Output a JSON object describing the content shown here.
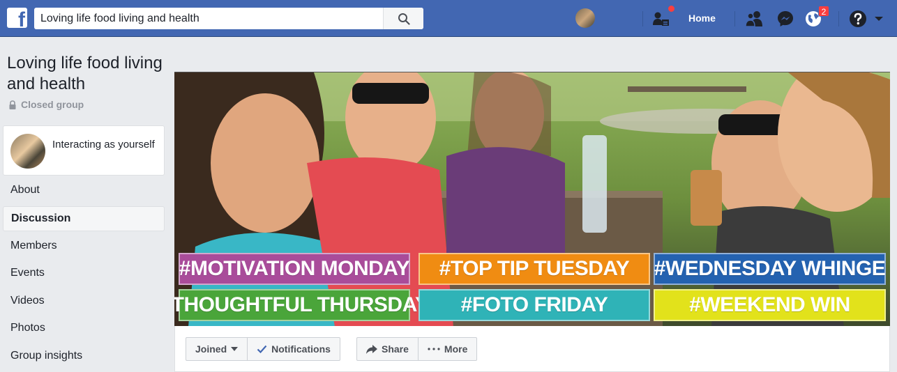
{
  "topbar": {
    "search_value": "Loving life food living and health",
    "home_label": "Home",
    "notifications_count": "2",
    "brand_color": "#4267b2"
  },
  "group": {
    "title": "Loving life food living and health",
    "privacy": "Closed group"
  },
  "interacting": {
    "text": "Interacting as yourself"
  },
  "sidebar": {
    "items": [
      {
        "label": "About"
      },
      {
        "label": "Discussion"
      },
      {
        "label": "Members"
      },
      {
        "label": "Events"
      },
      {
        "label": "Videos"
      },
      {
        "label": "Photos"
      },
      {
        "label": "Group insights"
      }
    ]
  },
  "cover": {
    "tags": [
      {
        "text": "#MOTIVATION MONDAY",
        "color": "#a94c9a"
      },
      {
        "text": "#TOP TIP TUESDAY",
        "color": "#f08c12"
      },
      {
        "text": "#WEDNESDAY WHINGE",
        "color": "#2462b0"
      },
      {
        "text": "#THOUGHTFUL THURSDAY",
        "color": "#4aa53a"
      },
      {
        "text": "#FOTO FRIDAY",
        "color": "#2fb3b7"
      },
      {
        "text": "#WEEKEND WIN",
        "color": "#e2e21b"
      }
    ]
  },
  "actions": {
    "joined": "Joined",
    "notifications": "Notifications",
    "share": "Share",
    "more": "More"
  }
}
